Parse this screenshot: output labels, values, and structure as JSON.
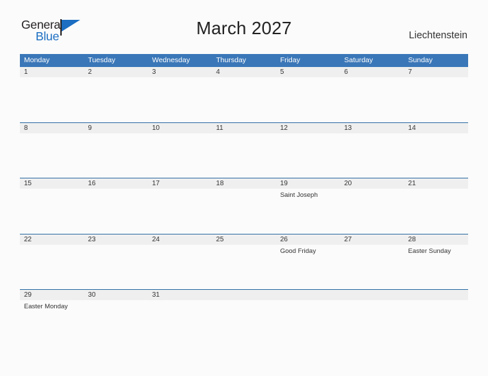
{
  "logo": {
    "word_one": "General",
    "word_two": "Blue",
    "flag_icon": "flag-icon",
    "brand_color": "#1b6ec2",
    "text_color": "#231f20"
  },
  "header": {
    "title": "March 2027",
    "country": "Liechtenstein"
  },
  "theme": {
    "header_blue": "#3a77b8",
    "row_line_blue": "#2e6da4",
    "band_gray": "#efefef",
    "page_bg": "#fbfbfb"
  },
  "calendar": {
    "weekdays": [
      "Monday",
      "Tuesday",
      "Wednesday",
      "Thursday",
      "Friday",
      "Saturday",
      "Sunday"
    ],
    "weeks": [
      {
        "days": [
          {
            "num": "1",
            "events": []
          },
          {
            "num": "2",
            "events": []
          },
          {
            "num": "3",
            "events": []
          },
          {
            "num": "4",
            "events": []
          },
          {
            "num": "5",
            "events": []
          },
          {
            "num": "6",
            "events": []
          },
          {
            "num": "7",
            "events": []
          }
        ]
      },
      {
        "days": [
          {
            "num": "8",
            "events": []
          },
          {
            "num": "9",
            "events": []
          },
          {
            "num": "10",
            "events": []
          },
          {
            "num": "11",
            "events": []
          },
          {
            "num": "12",
            "events": []
          },
          {
            "num": "13",
            "events": []
          },
          {
            "num": "14",
            "events": []
          }
        ]
      },
      {
        "days": [
          {
            "num": "15",
            "events": []
          },
          {
            "num": "16",
            "events": []
          },
          {
            "num": "17",
            "events": []
          },
          {
            "num": "18",
            "events": []
          },
          {
            "num": "19",
            "events": [
              "Saint Joseph"
            ]
          },
          {
            "num": "20",
            "events": []
          },
          {
            "num": "21",
            "events": []
          }
        ]
      },
      {
        "days": [
          {
            "num": "22",
            "events": []
          },
          {
            "num": "23",
            "events": []
          },
          {
            "num": "24",
            "events": []
          },
          {
            "num": "25",
            "events": []
          },
          {
            "num": "26",
            "events": [
              "Good Friday"
            ]
          },
          {
            "num": "27",
            "events": []
          },
          {
            "num": "28",
            "events": [
              "Easter Sunday"
            ]
          }
        ]
      },
      {
        "days": [
          {
            "num": "29",
            "events": [
              "Easter Monday"
            ]
          },
          {
            "num": "30",
            "events": []
          },
          {
            "num": "31",
            "events": []
          },
          {
            "num": "",
            "events": []
          },
          {
            "num": "",
            "events": []
          },
          {
            "num": "",
            "events": []
          },
          {
            "num": "",
            "events": []
          }
        ]
      }
    ]
  }
}
